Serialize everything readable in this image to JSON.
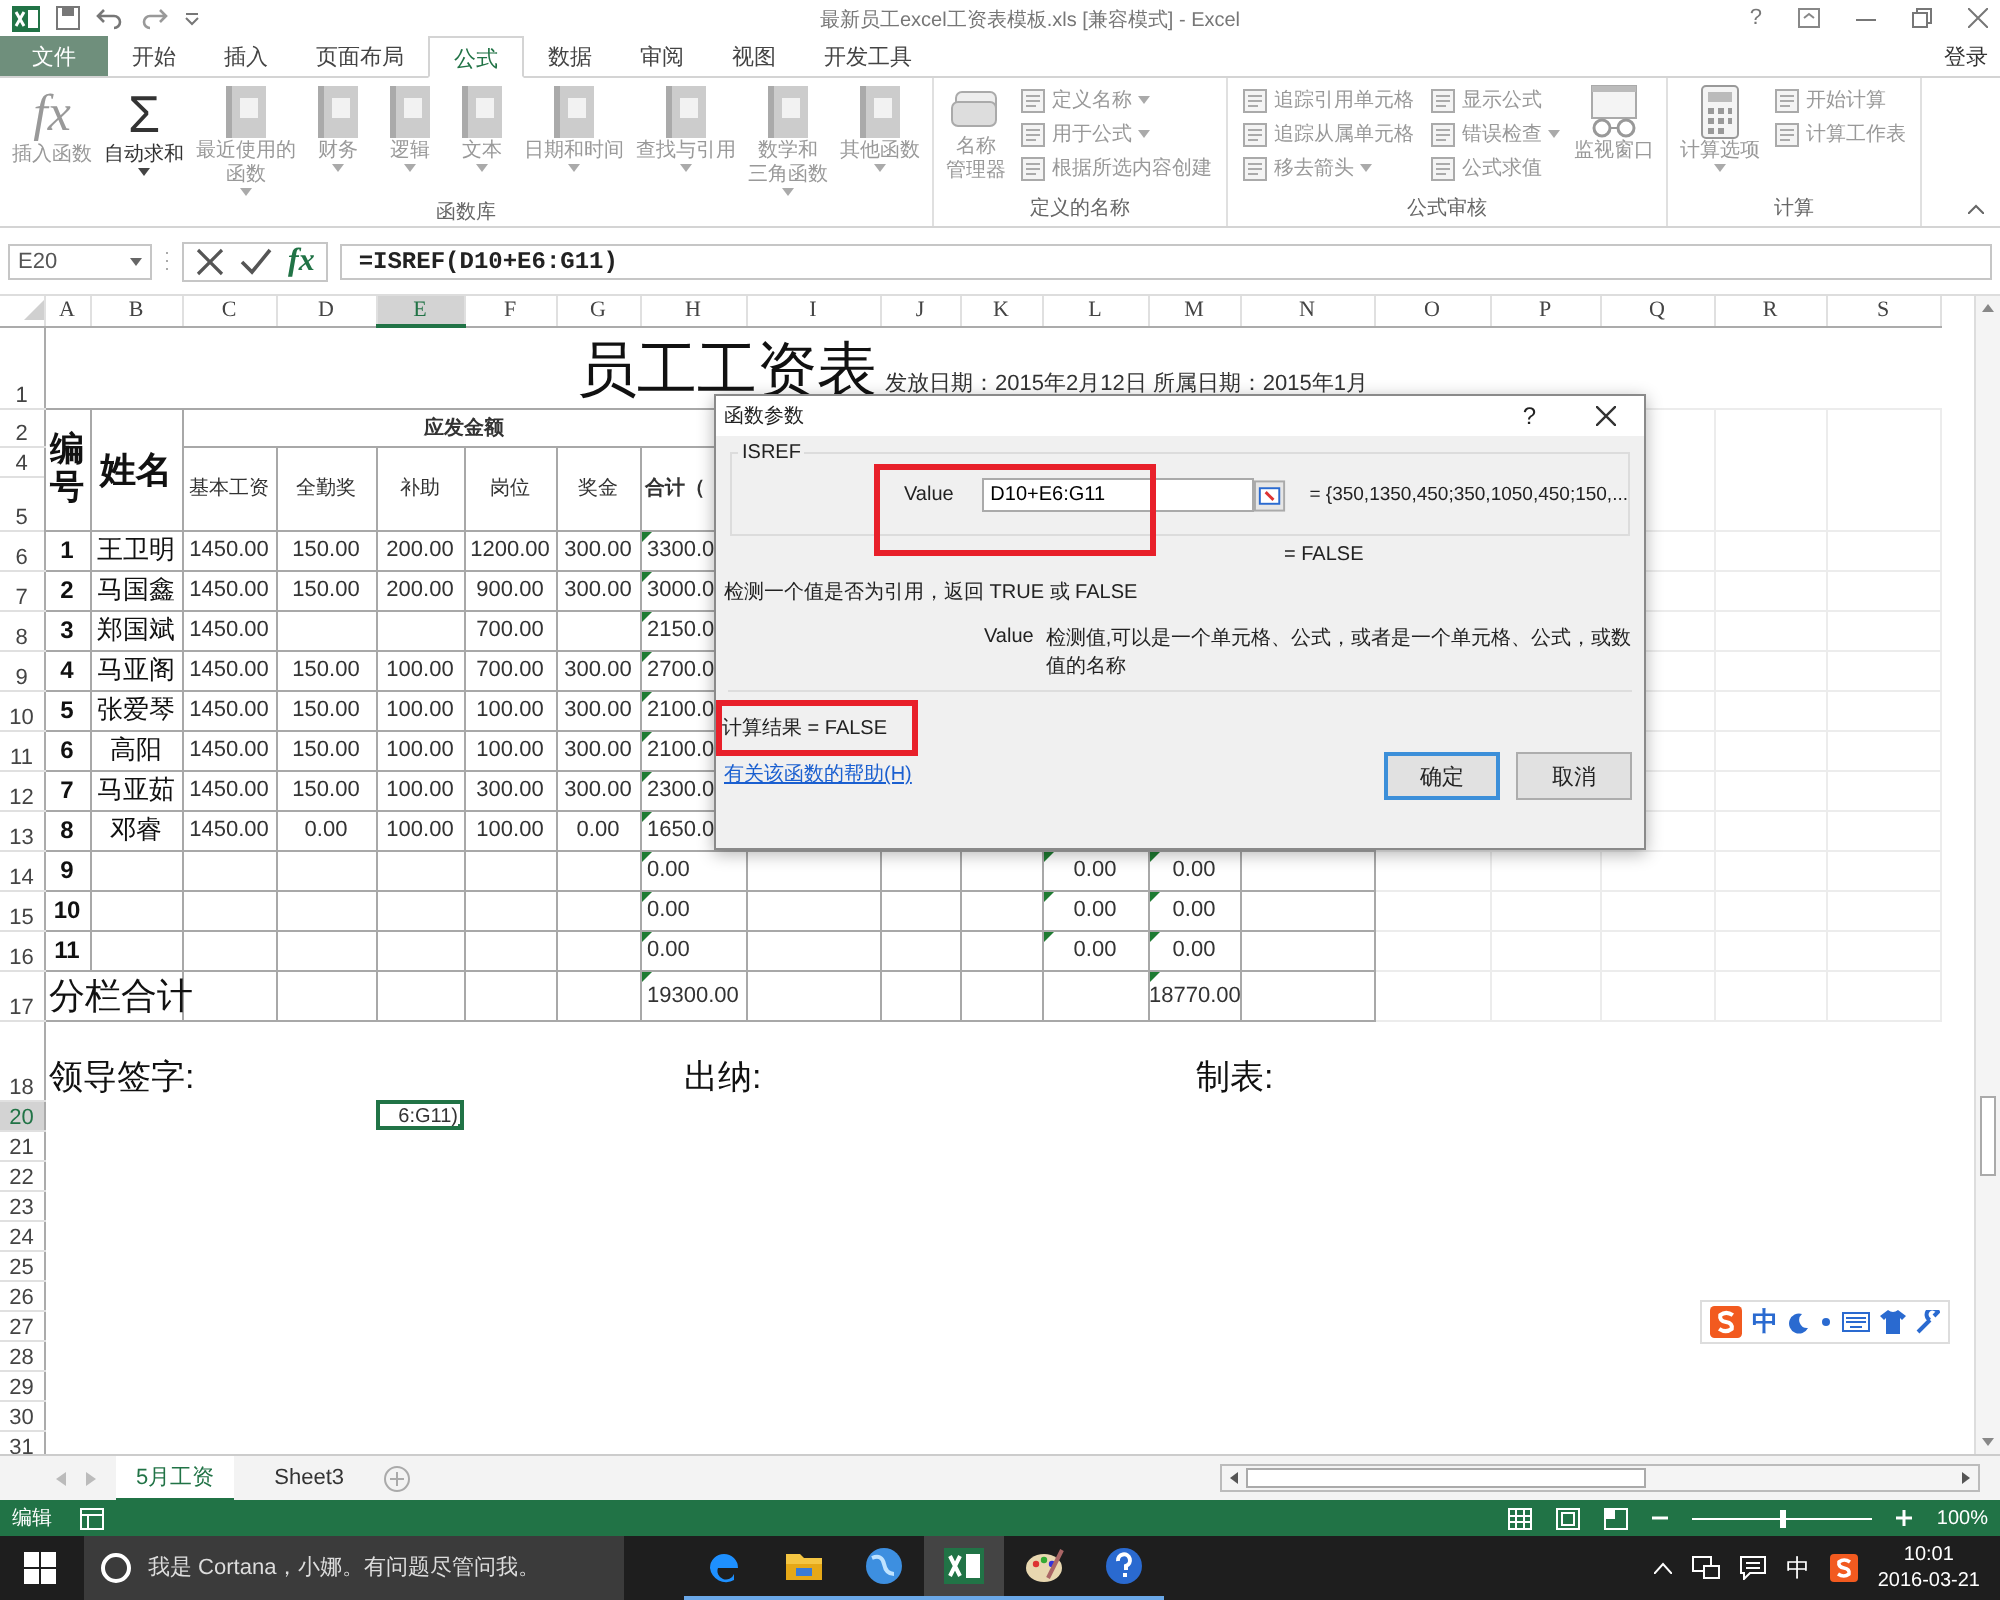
{
  "window": {
    "title": "最新员工excel工资表模板.xls  [兼容模式] - Excel",
    "help": "?"
  },
  "ribbon_tabs": [
    {
      "label": "文件",
      "kind": "file",
      "selected": false
    },
    {
      "label": "开始",
      "kind": "tab",
      "selected": false
    },
    {
      "label": "插入",
      "kind": "tab",
      "selected": false
    },
    {
      "label": "页面布局",
      "kind": "tab",
      "selected": false
    },
    {
      "label": "公式",
      "kind": "tab",
      "selected": true
    },
    {
      "label": "数据",
      "kind": "tab",
      "selected": false
    },
    {
      "label": "审阅",
      "kind": "tab",
      "selected": false
    },
    {
      "label": "视图",
      "kind": "tab",
      "selected": false
    },
    {
      "label": "开发工具",
      "kind": "tab",
      "selected": false
    }
  ],
  "account": "登录",
  "ribbon_groups": [
    {
      "label": "函数库",
      "items": [
        {
          "kind": "large",
          "glyph": "fx",
          "lines": [
            "插入函数"
          ],
          "disabled": true,
          "dropdown": false
        },
        {
          "kind": "large",
          "glyph": "Σ",
          "lines": [
            "自动求和"
          ],
          "disabled": false,
          "dropdown": true
        },
        {
          "kind": "large",
          "lines": [
            "最近使用的",
            "函数"
          ],
          "disabled": true,
          "dropdown": true
        },
        {
          "kind": "large",
          "lines": [
            "财务"
          ],
          "disabled": true,
          "dropdown": true
        },
        {
          "kind": "large",
          "lines": [
            "逻辑"
          ],
          "disabled": true,
          "dropdown": true
        },
        {
          "kind": "large",
          "lines": [
            "文本"
          ],
          "disabled": true,
          "dropdown": true
        },
        {
          "kind": "large",
          "lines": [
            "日期和时间"
          ],
          "disabled": true,
          "dropdown": true
        },
        {
          "kind": "large",
          "lines": [
            "查找与引用"
          ],
          "disabled": true,
          "dropdown": true
        },
        {
          "kind": "large",
          "lines": [
            "数学和",
            "三角函数"
          ],
          "disabled": true,
          "dropdown": true
        },
        {
          "kind": "large",
          "lines": [
            "其他函数"
          ],
          "disabled": true,
          "dropdown": true
        }
      ]
    },
    {
      "label": "定义的名称",
      "items": [
        {
          "kind": "large",
          "lines": [
            "名称",
            "管理器"
          ],
          "disabled": true,
          "dropdown": false
        },
        {
          "kind": "stack",
          "items": [
            {
              "label": "定义名称",
              "disabled": true,
              "dropdown": true
            },
            {
              "label": "用于公式",
              "disabled": true,
              "dropdown": true
            },
            {
              "label": "根据所选内容创建",
              "disabled": true,
              "dropdown": false
            }
          ]
        }
      ]
    },
    {
      "label": "公式审核",
      "items": [
        {
          "kind": "stack",
          "items": [
            {
              "label": "追踪引用单元格",
              "disabled": true,
              "dropdown": false
            },
            {
              "label": "追踪从属单元格",
              "disabled": true,
              "dropdown": false
            },
            {
              "label": "移去箭头",
              "disabled": true,
              "dropdown": true
            }
          ]
        },
        {
          "kind": "stack",
          "items": [
            {
              "label": "显示公式",
              "disabled": true,
              "dropdown": false
            },
            {
              "label": "错误检查",
              "disabled": true,
              "dropdown": true
            },
            {
              "label": "公式求值",
              "disabled": true,
              "dropdown": false
            }
          ]
        },
        {
          "kind": "large",
          "lines": [
            "监视窗口"
          ],
          "disabled": true,
          "dropdown": false
        }
      ]
    },
    {
      "label": "计算",
      "items": [
        {
          "kind": "large",
          "lines": [
            "计算选项"
          ],
          "disabled": true,
          "dropdown": true
        },
        {
          "kind": "stack",
          "items": [
            {
              "label": "开始计算",
              "disabled": true,
              "dropdown": false
            },
            {
              "label": "计算工作表",
              "disabled": true,
              "dropdown": false
            }
          ]
        }
      ]
    }
  ],
  "formula_bar": {
    "name_box": "E20",
    "function_glyph": "fx",
    "formula": "=ISREF(D10+E6:G11)"
  },
  "columns": [
    {
      "label": "A",
      "selected": false
    },
    {
      "label": "B",
      "selected": false
    },
    {
      "label": "C",
      "selected": false
    },
    {
      "label": "D",
      "selected": false
    },
    {
      "label": "E",
      "selected": true
    },
    {
      "label": "F",
      "selected": false
    },
    {
      "label": "G",
      "selected": false
    },
    {
      "label": "H",
      "selected": false
    },
    {
      "label": "I",
      "selected": false
    },
    {
      "label": "J",
      "selected": false
    },
    {
      "label": "K",
      "selected": false
    },
    {
      "label": "L",
      "selected": false
    },
    {
      "label": "M",
      "selected": false
    },
    {
      "label": "N",
      "selected": false
    },
    {
      "label": "O",
      "selected": false
    },
    {
      "label": "P",
      "selected": false
    },
    {
      "label": "Q",
      "selected": false
    },
    {
      "label": "R",
      "selected": false
    },
    {
      "label": "S",
      "selected": false
    }
  ],
  "rows": [
    {
      "header": "1",
      "kind": "title",
      "selected": false,
      "title": "员工工资表",
      "subtitle": "发放日期：2015年2月12日 所属日期：2015年1月"
    },
    {
      "header": "2",
      "kind": "head_top",
      "selected": false,
      "cells": {
        "a": "编号",
        "b": "姓名",
        "c": "应发金额"
      }
    },
    {
      "header": "4",
      "kind": "head_sub",
      "selected": false,
      "cells": {
        "c": "基本工资",
        "d": "全勤奖",
        "e": "补助",
        "f": "岗位",
        "g": "奖金",
        "h": "合计（"
      }
    },
    {
      "header": "5",
      "kind": "head_end",
      "selected": false
    },
    {
      "header": "6",
      "kind": "data",
      "selected": false,
      "cells": {
        "a": "1",
        "b": "王卫明",
        "c": "1450.00",
        "d": "150.00",
        "e": "200.00",
        "f": "1200.00",
        "g": "300.00",
        "h": {
          "text": "3300.0",
          "flag": true
        }
      }
    },
    {
      "header": "7",
      "kind": "data",
      "selected": false,
      "cells": {
        "a": "2",
        "b": "马国鑫",
        "c": "1450.00",
        "d": "150.00",
        "e": "200.00",
        "f": "900.00",
        "g": "300.00",
        "h": {
          "text": "3000.0",
          "flag": true
        }
      }
    },
    {
      "header": "8",
      "kind": "data",
      "selected": false,
      "cells": {
        "a": "3",
        "b": "郑国斌",
        "c": "1450.00",
        "f": "700.00",
        "h": {
          "text": "2150.0",
          "flag": true
        }
      }
    },
    {
      "header": "9",
      "kind": "data",
      "selected": false,
      "cells": {
        "a": "4",
        "b": "马亚阁",
        "c": "1450.00",
        "d": "150.00",
        "e": "100.00",
        "f": "700.00",
        "g": "300.00",
        "h": {
          "text": "2700.0",
          "flag": true
        }
      }
    },
    {
      "header": "10",
      "kind": "data",
      "selected": false,
      "cells": {
        "a": "5",
        "b": "张爱琴",
        "c": "1450.00",
        "d": "150.00",
        "e": "100.00",
        "f": "100.00",
        "g": "300.00",
        "h": {
          "text": "2100.0",
          "flag": true
        }
      }
    },
    {
      "header": "11",
      "kind": "data",
      "selected": false,
      "cells": {
        "a": "6",
        "b": "高阳",
        "c": "1450.00",
        "d": "150.00",
        "e": "100.00",
        "f": "100.00",
        "g": "300.00",
        "h": {
          "text": "2100.0",
          "flag": true
        }
      }
    },
    {
      "header": "12",
      "kind": "data",
      "selected": false,
      "cells": {
        "a": "7",
        "b": "马亚茹",
        "c": "1450.00",
        "d": "150.00",
        "e": "100.00",
        "f": "300.00",
        "g": "300.00",
        "h": {
          "text": "2300.0",
          "flag": true
        }
      }
    },
    {
      "header": "13",
      "kind": "data",
      "selected": false,
      "cells": {
        "a": "8",
        "b": "邓睿",
        "c": "1450.00",
        "d": "0.00",
        "e": "100.00",
        "f": "100.00",
        "g": "0.00",
        "h": {
          "text": "1650.0",
          "flag": true
        }
      }
    },
    {
      "header": "14",
      "kind": "data",
      "selected": false,
      "cells": {
        "a": "9",
        "h": {
          "text": "0.00",
          "flag": true
        },
        "l": {
          "text": "0.00",
          "flag": true
        },
        "m": {
          "text": "0.00",
          "flag": true
        }
      }
    },
    {
      "header": "15",
      "kind": "data",
      "selected": false,
      "cells": {
        "a": "10",
        "h": {
          "text": "0.00",
          "flag": true
        },
        "l": {
          "text": "0.00",
          "flag": true
        },
        "m": {
          "text": "0.00",
          "flag": true
        }
      }
    },
    {
      "header": "16",
      "kind": "data",
      "selected": false,
      "cells": {
        "a": "11",
        "h": {
          "text": "0.00",
          "flag": true
        },
        "l": {
          "text": "0.00",
          "flag": true
        },
        "m": {
          "text": "0.00",
          "flag": true
        }
      }
    },
    {
      "header": "17",
      "kind": "total",
      "selected": false,
      "cells": {
        "a": "分栏合计",
        "h": {
          "text": "19300.00",
          "flag": true
        },
        "m": {
          "text": "18770.00",
          "flag": true
        }
      }
    },
    {
      "header": "18",
      "kind": "signature",
      "selected": false,
      "cells": {
        "a": "领导签字:",
        "h": "出纳:",
        "m": "制表:"
      }
    },
    {
      "header": "20",
      "kind": "plain",
      "selected": true,
      "cells": {
        "e": {
          "text": "6:G11)",
          "selected": true
        }
      }
    },
    {
      "header": "21",
      "kind": "plain",
      "selected": false
    },
    {
      "header": "22",
      "kind": "plain",
      "selected": false
    },
    {
      "header": "23",
      "kind": "plain",
      "selected": false
    },
    {
      "header": "24",
      "kind": "plain",
      "selected": false
    },
    {
      "header": "25",
      "kind": "plain",
      "selected": false
    },
    {
      "header": "26",
      "kind": "plain",
      "selected": false
    },
    {
      "header": "27",
      "kind": "plain",
      "selected": false
    },
    {
      "header": "28",
      "kind": "plain",
      "selected": false
    },
    {
      "header": "29",
      "kind": "plain",
      "selected": false
    },
    {
      "header": "30",
      "kind": "plain",
      "selected": false
    },
    {
      "header": "31",
      "kind": "plain",
      "selected": false
    }
  ],
  "dialog": {
    "title": "函数参数",
    "help": "?",
    "function_name": "ISREF",
    "arg_label": "Value",
    "arg_value": "D10+E6:G11",
    "arg_result": "= {350,1350,450;350,1050,450;150,...",
    "result_line": "= FALSE",
    "description": "检测一个值是否为引用，返回 TRUE 或 FALSE",
    "arg_help_label": "Value",
    "arg_help": "检测值,可以是一个单元格、公式，或者是一个单元格、公式，或数值的名称",
    "computed": "计算结果 =   FALSE",
    "help_link": "有关该函数的帮助(H)",
    "buttons": [
      {
        "label": "确定",
        "kind": "default"
      },
      {
        "label": "取消",
        "kind": "normal"
      }
    ]
  },
  "ime_toolbar": {
    "mode": "中"
  },
  "sheet_tabs": [
    {
      "label": "5月工资",
      "selected": true
    },
    {
      "label": "Sheet3",
      "selected": false
    }
  ],
  "status_bar": {
    "mode": "编辑",
    "zoom": {
      "level": 0.5,
      "reading": "100%"
    }
  },
  "taskbar": {
    "search_placeholder": "我是 Cortana，小娜。有问题尽管问我。",
    "apps": [
      {
        "kind": "edge",
        "selected": false
      },
      {
        "kind": "folder",
        "selected": false
      },
      {
        "kind": "globe",
        "selected": false
      },
      {
        "kind": "excel",
        "selected": true
      },
      {
        "kind": "paint",
        "selected": false
      },
      {
        "kind": "help",
        "selected": false
      }
    ],
    "input_mode": "中",
    "time": "10:01",
    "date": "2016-03-21"
  }
}
